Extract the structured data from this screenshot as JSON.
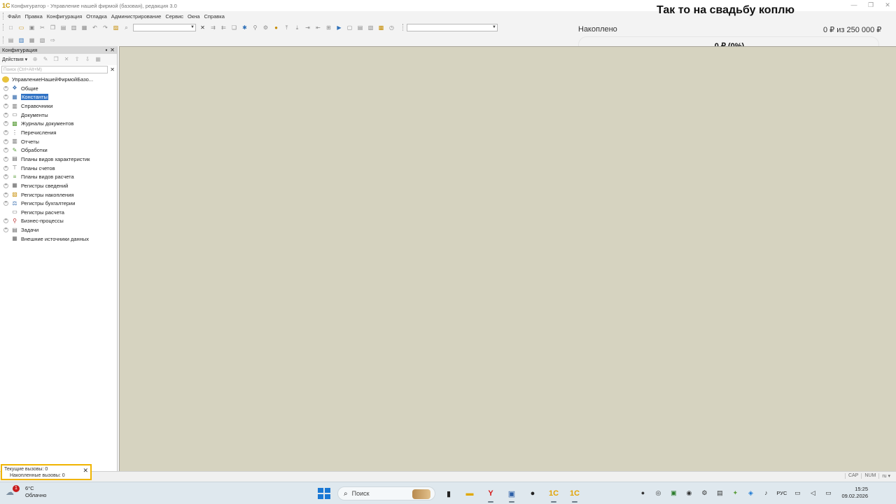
{
  "window": {
    "title": "Конфигуратор - Управление нашей фирмой (базовая), редакция 3.0",
    "app_icon": "1c-app-icon"
  },
  "menu": [
    "Файл",
    "Правка",
    "Конфигурация",
    "Отладка",
    "Администрирование",
    "Сервис",
    "Окна",
    "Справка"
  ],
  "goal": {
    "title": "Так то на свадьбу коплю",
    "label": "Накоплено",
    "amount": "0 ₽ из 250 000 ₽",
    "percent_text": "0 ₽ (0%)",
    "progress": 0
  },
  "panel": {
    "title": "Конфигурация",
    "actions_label": "Действия ▾",
    "search_placeholder": "Поиск (Ctrl+Alt+M)",
    "root": "УправлениеНашейФирмойБазо...",
    "items": [
      {
        "label": "Общие",
        "icon": "common-icon",
        "expand": true,
        "selected": false
      },
      {
        "label": "Константы",
        "icon": "constants-icon",
        "expand": true,
        "selected": true
      },
      {
        "label": "Справочники",
        "icon": "catalogs-icon",
        "expand": true,
        "selected": false
      },
      {
        "label": "Документы",
        "icon": "documents-icon",
        "expand": true,
        "selected": false
      },
      {
        "label": "Журналы документов",
        "icon": "journals-icon",
        "expand": true,
        "selected": false
      },
      {
        "label": "Перечисления",
        "icon": "enums-icon",
        "expand": true,
        "selected": false
      },
      {
        "label": "Отчеты",
        "icon": "reports-icon",
        "expand": true,
        "selected": false
      },
      {
        "label": "Обработки",
        "icon": "processing-icon",
        "expand": true,
        "selected": false
      },
      {
        "label": "Планы видов характеристик",
        "icon": "char-types-icon",
        "expand": true,
        "selected": false
      },
      {
        "label": "Планы счетов",
        "icon": "accounts-icon",
        "expand": true,
        "selected": false
      },
      {
        "label": "Планы видов расчета",
        "icon": "calc-types-icon",
        "expand": true,
        "selected": false
      },
      {
        "label": "Регистры сведений",
        "icon": "info-registers-icon",
        "expand": true,
        "selected": false
      },
      {
        "label": "Регистры накопления",
        "icon": "accum-registers-icon",
        "expand": true,
        "selected": false
      },
      {
        "label": "Регистры бухгалтерии",
        "icon": "acc-registers-icon",
        "expand": true,
        "selected": false
      },
      {
        "label": "Регистры расчета",
        "icon": "calc-registers-icon",
        "expand": false,
        "selected": false
      },
      {
        "label": "Бизнес-процессы",
        "icon": "business-process-icon",
        "expand": true,
        "selected": false
      },
      {
        "label": "Задачи",
        "icon": "tasks-icon",
        "expand": true,
        "selected": false
      },
      {
        "label": "Внешние источники данных",
        "icon": "external-sources-icon",
        "expand": false,
        "selected": false
      }
    ]
  },
  "calls": {
    "current": "Текущие вызовы: 0",
    "accumulated": "Накопленные вызовы: 0"
  },
  "status": {
    "cap": "CAP",
    "num": "NUM",
    "lang": "ru ▾"
  },
  "taskbar": {
    "weather_temp": "6°C",
    "weather_desc": "Облачно",
    "weather_badge": "1",
    "search_label": "Поиск",
    "lang": "РУС",
    "time": "15:25",
    "date": "09.02.2026"
  },
  "colors": {
    "main_bg": "#d6d3c0",
    "selection": "#3072c4",
    "calls_border": "#f0b400",
    "progress_fill": "#4caf50"
  }
}
